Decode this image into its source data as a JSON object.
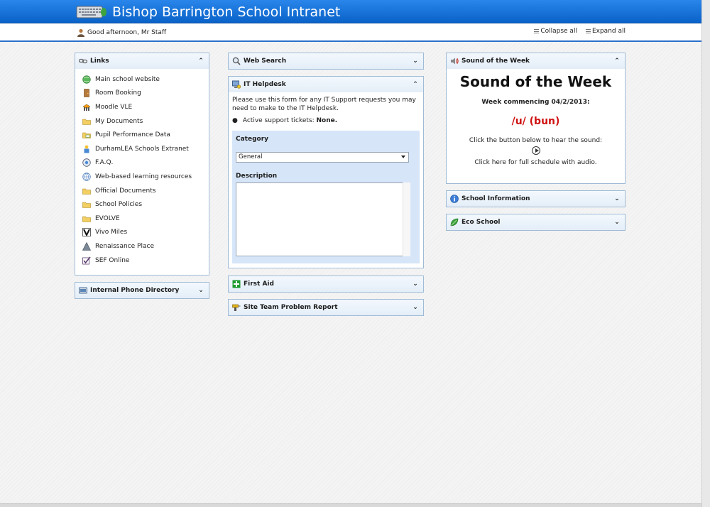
{
  "header": {
    "title": "Bishop Barrington School Intranet",
    "greeting": "Good afternoon, Mr Staff",
    "collapse_all": "Collapse all",
    "expand_all": "Expand all",
    "brand_color": "#1a73d6"
  },
  "links": {
    "title": "Links",
    "items": [
      {
        "label": "Main school website",
        "icon": "globe-icon"
      },
      {
        "label": "Room Booking",
        "icon": "door-icon"
      },
      {
        "label": "Moodle VLE",
        "icon": "moodle-icon"
      },
      {
        "label": "My Documents",
        "icon": "folder-icon"
      },
      {
        "label": "Pupil Performance Data",
        "icon": "spreadsheet-icon"
      },
      {
        "label": "DurhamLEA Schools Extranet",
        "icon": "extranet-icon"
      },
      {
        "label": "F.A.Q.",
        "icon": "help-icon"
      },
      {
        "label": "Web-based learning resources",
        "icon": "web-icon"
      },
      {
        "label": "Official Documents",
        "icon": "folder-icon"
      },
      {
        "label": "School Policies",
        "icon": "folder-icon"
      },
      {
        "label": "EVOLVE",
        "icon": "folder-icon"
      },
      {
        "label": "Vivo Miles",
        "icon": "vivo-icon"
      },
      {
        "label": "Renaissance Place",
        "icon": "renaissance-icon"
      },
      {
        "label": "SEF Online",
        "icon": "checkbox-icon"
      }
    ]
  },
  "phone_directory": {
    "title": "Internal Phone Directory"
  },
  "web_search": {
    "title": "Web Search"
  },
  "helpdesk": {
    "title": "IT Helpdesk",
    "intro": "Please use this form for any IT Support requests you may need to make to the IT Helpdesk.",
    "tickets_label": "Active support tickets:",
    "tickets_value": "None.",
    "category_label": "Category",
    "category_value": "General",
    "description_label": "Description",
    "description_value": ""
  },
  "first_aid": {
    "title": "First Aid"
  },
  "site_team": {
    "title": "Site Team Problem Report"
  },
  "sound_of_week": {
    "panel_title": "Sound of the Week",
    "heading": "Sound of the Week",
    "week": "Week commencing 04/2/2013:",
    "sound": "/u/ (bun)",
    "prompt": "Click the button below to hear the sound:",
    "schedule_link": "Click here for full schedule with audio.",
    "sound_color": "#d01212"
  },
  "school_info": {
    "title": "School Information"
  },
  "eco_school": {
    "title": "Eco School"
  }
}
